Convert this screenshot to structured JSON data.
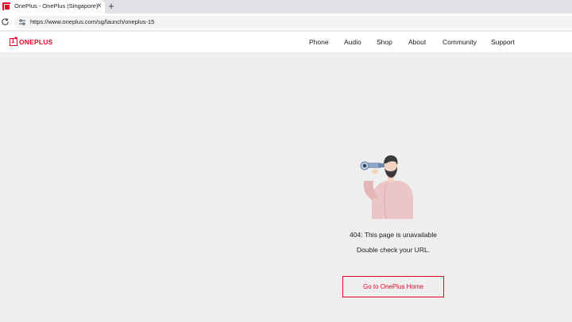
{
  "browser": {
    "tab_title": "OnePlus - OnePlus (Singapore)",
    "close_glyph": "×",
    "newtab_glyph": "+",
    "url": "https://www.oneplus.com/sg/launch/oneplus-15"
  },
  "header": {
    "logo_text": "ONEPLUS",
    "nav": [
      "Phone",
      "Audio",
      "Shop",
      "About",
      "Community",
      "Support"
    ]
  },
  "error": {
    "title": "404: This page is unavailable",
    "subtitle": "Double check your URL.",
    "button_label": "Go to OnePlus Home"
  },
  "colors": {
    "brand": "#eb0028",
    "page_bg": "#efefef"
  },
  "icons": {
    "favicon": "oneplus-favicon",
    "reload": "reload-icon",
    "site_info": "site-info-icon",
    "illustration": "man-with-binoculars-illustration"
  }
}
